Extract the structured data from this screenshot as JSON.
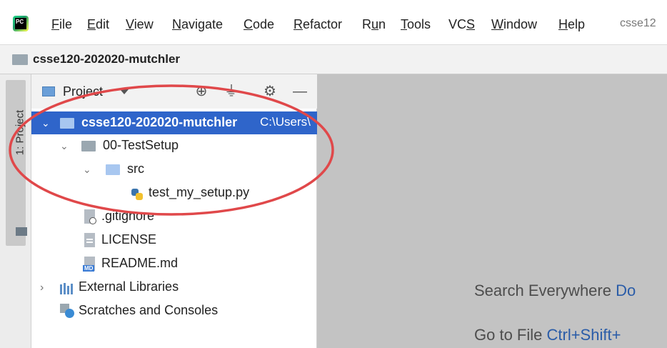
{
  "app": {
    "logo_text": "PC"
  },
  "menu": {
    "items": [
      {
        "label": "File"
      },
      {
        "label": "Edit"
      },
      {
        "label": "View"
      },
      {
        "label": "Navigate"
      },
      {
        "label": "Code"
      },
      {
        "label": "Refactor"
      },
      {
        "label": "Run"
      },
      {
        "label": "Tools"
      },
      {
        "label": "VCS"
      },
      {
        "label": "Window"
      },
      {
        "label": "Help"
      }
    ],
    "project_truncated": "csse12"
  },
  "navbar": {
    "project_name": "csse120-202020-mutchler"
  },
  "stripe": {
    "tab_label": "1: Project"
  },
  "panel": {
    "title": "Project",
    "tree": {
      "root": {
        "label": "csse120-202020-mutchler",
        "path": "C:\\Users\\"
      },
      "folder1": {
        "label": "00-TestSetup"
      },
      "folder2": {
        "label": "src"
      },
      "file_py": {
        "label": "test_my_setup.py"
      },
      "file_gitignore": {
        "label": ".gitignore"
      },
      "file_license": {
        "label": "LICENSE"
      },
      "file_readme": {
        "label": "README.md",
        "badge": "MD"
      },
      "libraries": {
        "label": "External Libraries"
      },
      "scratches": {
        "label": "Scratches and Consoles"
      }
    }
  },
  "editor": {
    "hints": [
      {
        "text": "Search Everywhere",
        "shortcut": "Do"
      },
      {
        "text": "Go to File",
        "shortcut": "Ctrl+Shift+"
      }
    ]
  },
  "colors": {
    "selection": "#2f65ca",
    "annotation": "#e0484a",
    "editor_bg": "#c3c3c3"
  }
}
